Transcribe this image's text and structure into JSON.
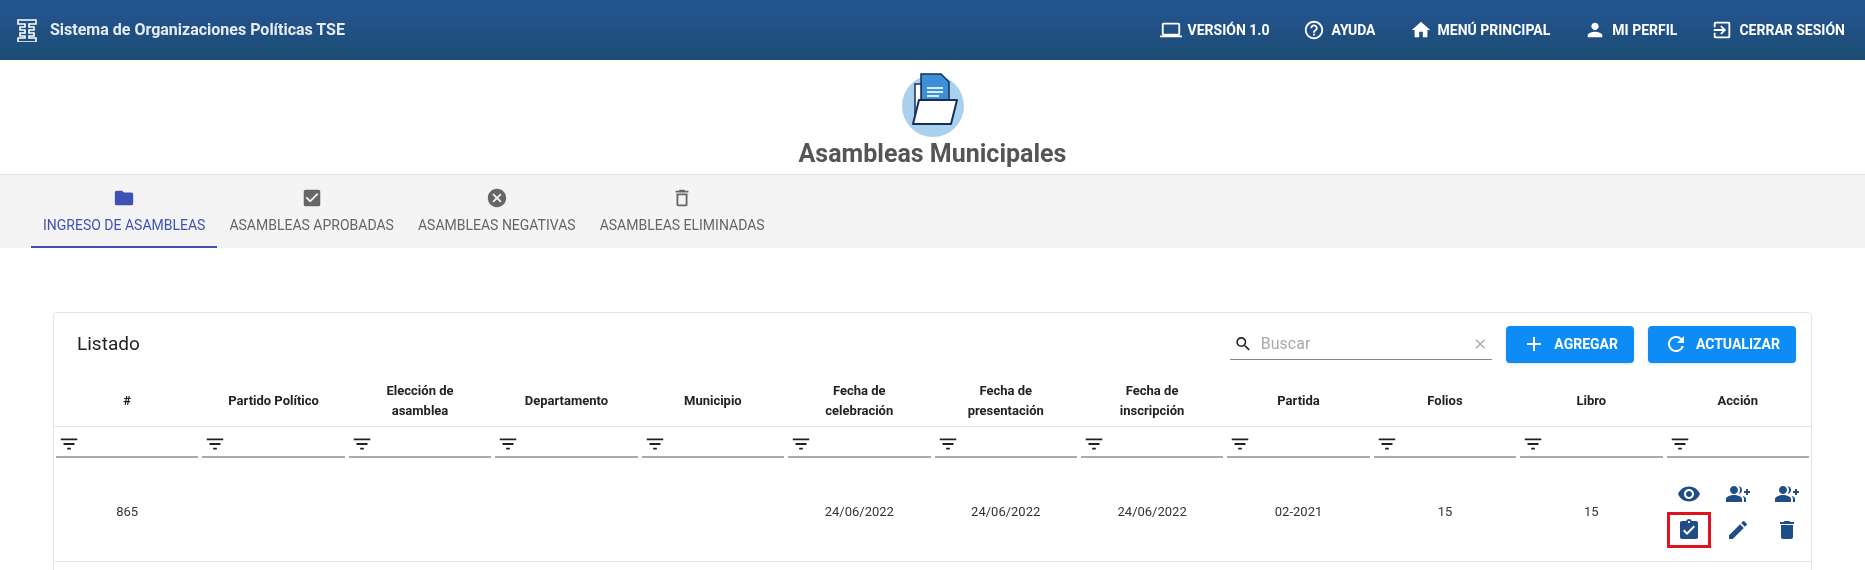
{
  "app_bar": {
    "title": "Sistema de Organizaciones Políticas TSE",
    "nav": [
      {
        "kind": "laptop",
        "label": "VERSIÓN 1.0"
      },
      {
        "kind": "help",
        "label": "AYUDA"
      },
      {
        "kind": "home",
        "label": "MENÚ PRINCIPAL"
      },
      {
        "kind": "person",
        "label": "MI PERFIL"
      },
      {
        "kind": "logout",
        "label": "CERRAR SESIÓN"
      }
    ]
  },
  "page": {
    "title": "Asambleas Municipales"
  },
  "tabs": [
    {
      "kind": "folder",
      "label": "INGRESO DE ASAMBLEAS",
      "selected": true
    },
    {
      "kind": "check",
      "label": "ASAMBLEAS APROBADAS",
      "selected": false
    },
    {
      "kind": "cancel",
      "label": "ASAMBLEAS NEGATIVAS",
      "selected": false
    },
    {
      "kind": "trash",
      "label": "ASAMBLEAS ELIMINADAS",
      "selected": false
    }
  ],
  "listado": {
    "title": "Listado",
    "search": {
      "placeholder": "Buscar"
    },
    "buttons": [
      {
        "kind": "add",
        "label": "AGREGAR"
      },
      {
        "kind": "refresh",
        "label": "ACTUALIZAR"
      }
    ],
    "table": {
      "columns": [
        "#",
        "Partido Político",
        "Elección de asamblea",
        "Departamento",
        "Municipio",
        "Fecha de celebración",
        "Fecha de presentación",
        "Fecha de inscripción",
        "Partida",
        "Folios",
        "Libro",
        "Acción"
      ],
      "rows": [
        {
          "cells": [
            "865",
            null,
            null,
            null,
            null,
            "24/06/2022",
            "24/06/2022",
            "24/06/2022",
            "02-2021",
            "15",
            "15"
          ],
          "actions": [
            {
              "kind": "view",
              "highlighted": false
            },
            {
              "kind": "group-add",
              "highlighted": false
            },
            {
              "kind": "group-add",
              "highlighted": false
            },
            {
              "kind": "approve",
              "highlighted": true
            },
            {
              "kind": "edit",
              "highlighted": false
            },
            {
              "kind": "delete",
              "highlighted": false
            }
          ]
        }
      ]
    }
  }
}
